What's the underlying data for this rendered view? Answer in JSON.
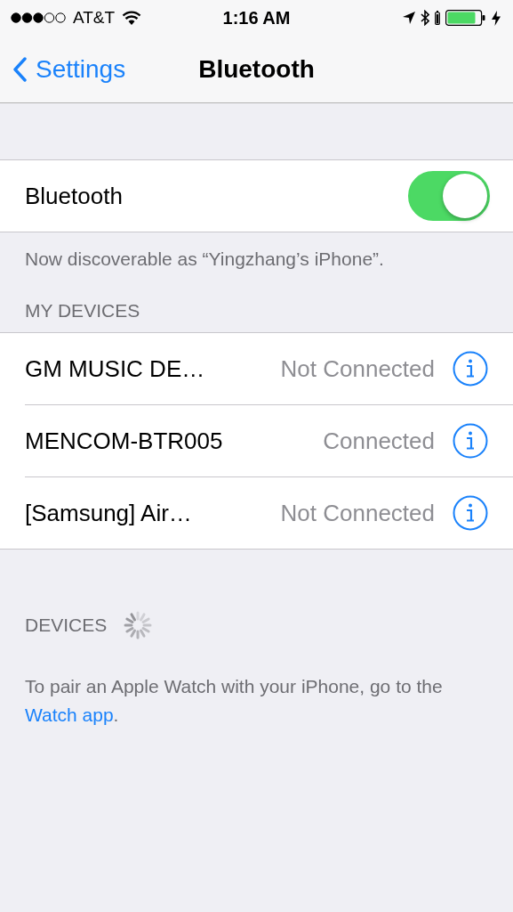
{
  "status_bar": {
    "carrier": "AT&T",
    "time": "1:16 AM"
  },
  "nav": {
    "back": "Settings",
    "title": "Bluetooth"
  },
  "bluetooth": {
    "label": "Bluetooth",
    "on": true
  },
  "discoverable_note": "Now discoverable as “Yingzhang’s iPhone”.",
  "my_devices": {
    "header": "MY DEVICES",
    "items": [
      {
        "name": "GM MUSIC DE…",
        "status": "Not Connected"
      },
      {
        "name": "MENCOM-BTR005",
        "status": "Connected"
      },
      {
        "name": "[Samsung] Air…",
        "status": "Not Connected"
      }
    ]
  },
  "devices": {
    "header": "DEVICES",
    "searching": true,
    "footer_text": "To pair an Apple Watch with your iPhone, go to the",
    "footer_link": "Watch app",
    "footer_end": "."
  }
}
